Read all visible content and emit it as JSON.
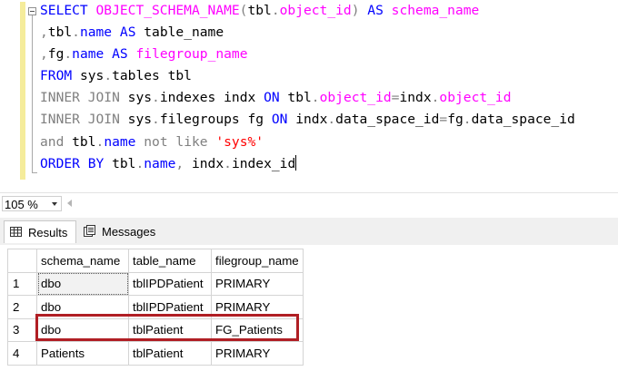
{
  "editor": {
    "lines": [
      [
        [
          "kw",
          "SELECT "
        ],
        [
          "fn",
          "OBJECT_SCHEMA_NAME"
        ],
        [
          "op",
          "("
        ],
        [
          "t",
          "tbl"
        ],
        [
          "op",
          "."
        ],
        [
          "fn",
          "object_id"
        ],
        [
          "op",
          ")"
        ],
        [
          "t",
          " "
        ],
        [
          "kw",
          "AS"
        ],
        [
          "t",
          " "
        ],
        [
          "fn",
          "schema_name"
        ]
      ],
      [
        [
          "op",
          ","
        ],
        [
          "t",
          "tbl"
        ],
        [
          "op",
          "."
        ],
        [
          "kw",
          "name"
        ],
        [
          "t",
          " "
        ],
        [
          "kw",
          "AS"
        ],
        [
          "t",
          " table_name"
        ]
      ],
      [
        [
          "op",
          ","
        ],
        [
          "t",
          "fg"
        ],
        [
          "op",
          "."
        ],
        [
          "kw",
          "name"
        ],
        [
          "t",
          " "
        ],
        [
          "kw",
          "AS"
        ],
        [
          "t",
          " "
        ],
        [
          "fn",
          "filegroup_name"
        ]
      ],
      [
        [
          "kw",
          "FROM"
        ],
        [
          "t",
          " sys"
        ],
        [
          "op",
          "."
        ],
        [
          "t",
          "tables tbl"
        ]
      ],
      [
        [
          "op",
          "INNER JOIN"
        ],
        [
          "t",
          " sys"
        ],
        [
          "op",
          "."
        ],
        [
          "t",
          "indexes indx "
        ],
        [
          "kw",
          "ON"
        ],
        [
          "t",
          " tbl"
        ],
        [
          "op",
          "."
        ],
        [
          "fn",
          "object_id"
        ],
        [
          "op",
          "="
        ],
        [
          "t",
          "indx"
        ],
        [
          "op",
          "."
        ],
        [
          "fn",
          "object_id"
        ]
      ],
      [
        [
          "op",
          "INNER JOIN"
        ],
        [
          "t",
          " sys"
        ],
        [
          "op",
          "."
        ],
        [
          "t",
          "filegroups fg "
        ],
        [
          "kw",
          "ON"
        ],
        [
          "t",
          " indx"
        ],
        [
          "op",
          "."
        ],
        [
          "t",
          "data_space_id"
        ],
        [
          "op",
          "="
        ],
        [
          "t",
          "fg"
        ],
        [
          "op",
          "."
        ],
        [
          "t",
          "data_space_id"
        ]
      ],
      [
        [
          "op",
          "and"
        ],
        [
          "t",
          " tbl"
        ],
        [
          "op",
          "."
        ],
        [
          "kw",
          "name"
        ],
        [
          "t",
          " "
        ],
        [
          "op",
          "not like"
        ],
        [
          "t",
          " "
        ],
        [
          "str",
          "'sys%'"
        ]
      ],
      [
        [
          "kw",
          "ORDER BY"
        ],
        [
          "t",
          " tbl"
        ],
        [
          "op",
          "."
        ],
        [
          "kw",
          "name"
        ],
        [
          "op",
          ","
        ],
        [
          "t",
          " indx"
        ],
        [
          "op",
          "."
        ],
        [
          "t",
          "index_id"
        ]
      ]
    ]
  },
  "zoom": {
    "value": "105 %"
  },
  "tabs": {
    "results": "Results",
    "messages": "Messages"
  },
  "grid": {
    "columns": [
      "schema_name",
      "table_name",
      "filegroup_name"
    ],
    "rows": [
      {
        "num": "1",
        "cells": [
          "dbo",
          "tblIPDPatient",
          "PRIMARY"
        ]
      },
      {
        "num": "2",
        "cells": [
          "dbo",
          "tblIPDPatient",
          "PRIMARY"
        ]
      },
      {
        "num": "3",
        "cells": [
          "dbo",
          "tblPatient",
          "FG_Patients"
        ]
      },
      {
        "num": "4",
        "cells": [
          "Patients",
          "tblPatient",
          "PRIMARY"
        ]
      }
    ]
  },
  "colors": {
    "keyword": "#0000ff",
    "function": "#ff00ff",
    "operator": "#808080",
    "string": "#ff0000",
    "highlight_border": "#b01e24"
  }
}
